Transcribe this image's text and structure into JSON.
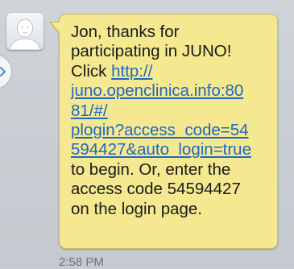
{
  "message": {
    "lines": [
      "Jon, thanks for",
      "participating in JUNO!",
      "Click "
    ],
    "link_lines": [
      "http://",
      "juno.openclinica.info:80",
      "81/#/",
      "plogin?access_code=54",
      "594427&auto_login=true"
    ],
    "tail_lines": [
      "to begin. Or, enter the",
      "access code 54594427",
      "on the login page."
    ],
    "link_url": "http://juno.openclinica.info:8081/#/plogin?access_code=54594427&auto_login=true"
  },
  "timestamp": "2:58 PM",
  "colors": {
    "bubble": "#f4e890",
    "link": "#1f67c2",
    "background": "#c8cdd3"
  },
  "icons": {
    "avatar": "default-contact-icon",
    "expand": "chevron-right-icon"
  }
}
